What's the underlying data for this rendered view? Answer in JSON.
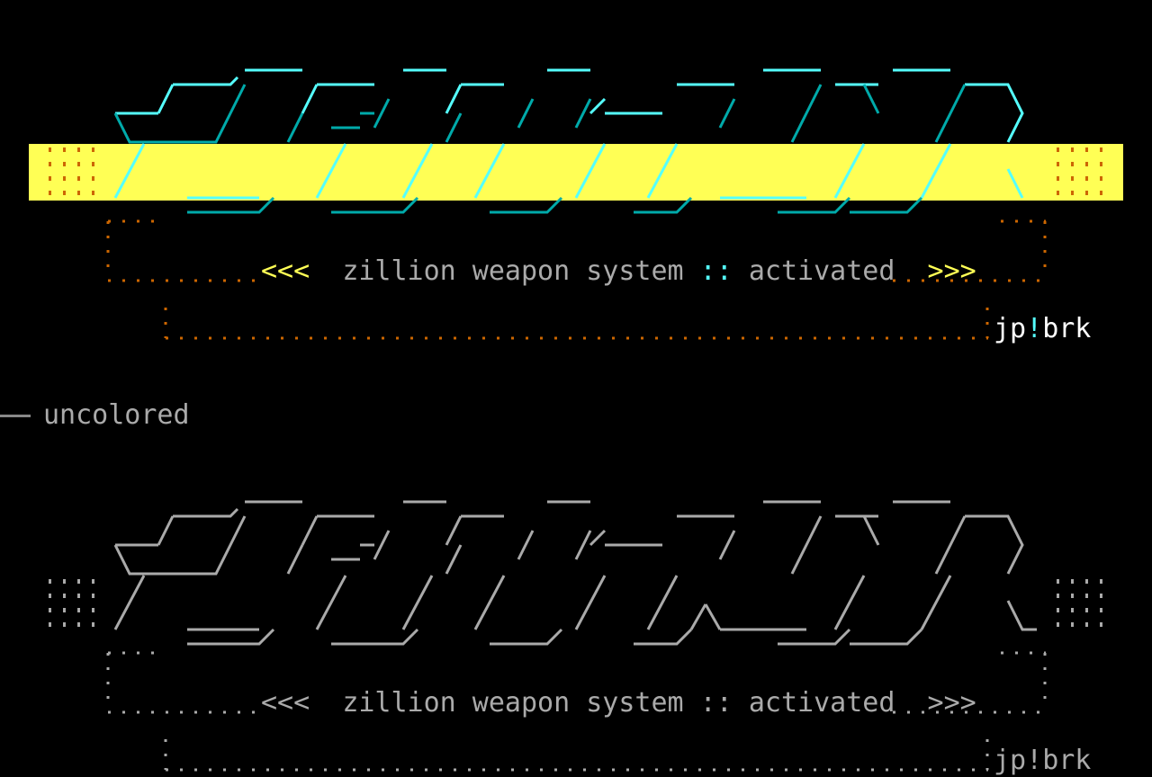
{
  "colored": {
    "tagline_open": "<<<",
    "tagline_text1": "zillion weapon system",
    "tagline_sep": "::",
    "tagline_text2": "activated",
    "tagline_close": ">>>",
    "signature_a": "jp",
    "signature_bang": "!",
    "signature_b": "brk"
  },
  "section_label": "uncolored",
  "uncolored": {
    "tagline_open": "<<<",
    "tagline_text1": "zillion weapon system",
    "tagline_sep": "::",
    "tagline_text2": "activated",
    "tagline_close": ">>>",
    "signature_a": "jp",
    "signature_bang": "!",
    "signature_b": "brk"
  },
  "colors": {
    "background": "#000000",
    "highlight_band": "#ffff55",
    "logo_cyan": "#55ffff",
    "logo_teal": "#00aaaa",
    "frame_orange": "#cc6600",
    "grey": "#aaaaaa"
  }
}
